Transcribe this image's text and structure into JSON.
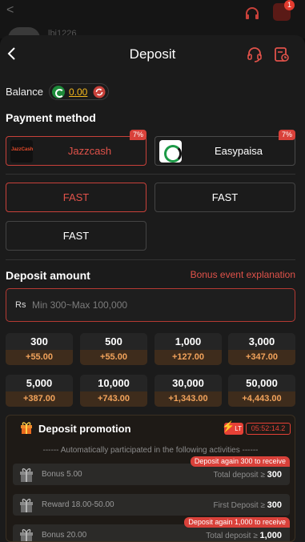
{
  "background": {
    "username": "lbj1226",
    "notification_count": "1"
  },
  "header": {
    "title": "Deposit"
  },
  "balance": {
    "label": "Balance",
    "value": "0.00"
  },
  "payment_method": {
    "title": "Payment method",
    "options": [
      {
        "label": "Jazzcash",
        "logo_text": "JazzCash",
        "tag": "7%",
        "selected": true
      },
      {
        "label": "Easypaisa",
        "tag": "7%",
        "selected": false
      }
    ]
  },
  "channels": [
    {
      "label": "FAST",
      "selected": true
    },
    {
      "label": "FAST",
      "selected": false
    },
    {
      "label": "FAST",
      "selected": false
    }
  ],
  "deposit_amount": {
    "title": "Deposit amount",
    "bonus_link": "Bonus event explanation",
    "currency": "Rs",
    "placeholder": "Min 300~Max 100,000"
  },
  "chips": [
    {
      "amount": "300",
      "bonus": "+55.00"
    },
    {
      "amount": "500",
      "bonus": "+55.00"
    },
    {
      "amount": "1,000",
      "bonus": "+127.00"
    },
    {
      "amount": "3,000",
      "bonus": "+347.00"
    },
    {
      "amount": "5,000",
      "bonus": "+387.00"
    },
    {
      "amount": "10,000",
      "bonus": "+743.00"
    },
    {
      "amount": "30,000",
      "bonus": "+1,343.00"
    },
    {
      "amount": "50,000",
      "bonus": "+4,443.00"
    }
  ],
  "promotion": {
    "title": "Deposit promotion",
    "lt_label": "LT",
    "timer": "05:52:14.2",
    "note": "------ Automatically participated in the following activities ------",
    "rows": [
      {
        "name": "Bonus 5.00",
        "cond_label": "Total deposit ≥",
        "cond_value": "300",
        "tag": "Deposit again 300 to receive"
      },
      {
        "name": "Reward 18.00-50.00",
        "cond_label": "First Deposit ≥",
        "cond_value": "300",
        "tag": ""
      },
      {
        "name": "Bonus 20.00",
        "cond_label": "Total deposit ≥",
        "cond_value": "1,000",
        "tag": "Deposit again 1,000 to receive"
      }
    ]
  },
  "colors": {
    "accent_red": "#e0524a",
    "gold": "#f5b81c",
    "bonus_orange": "#f2a35b",
    "sheet_bg": "#1b1b1b"
  }
}
